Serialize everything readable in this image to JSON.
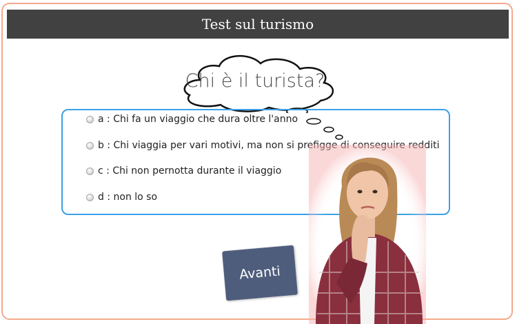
{
  "header": {
    "title": "Test sul turismo"
  },
  "question": {
    "text": "Chi è il turista?"
  },
  "options": [
    {
      "label": "a : Chi fa un viaggio che dura oltre l'anno"
    },
    {
      "label": "b : Chi viaggia per vari motivi, ma non si prefigge di conseguire redditi"
    },
    {
      "label": "c : Chi non pernotta durante il viaggio"
    },
    {
      "label": "d : non lo so"
    }
  ],
  "buttons": {
    "next_label": "Avanti"
  },
  "colors": {
    "title_bar": "#414141",
    "frame_border": "#f2a98c",
    "answers_border": "#3aa0e8",
    "next_button": "#4f5d7c"
  },
  "illustration": {
    "icon": "thinking-woman-icon"
  }
}
